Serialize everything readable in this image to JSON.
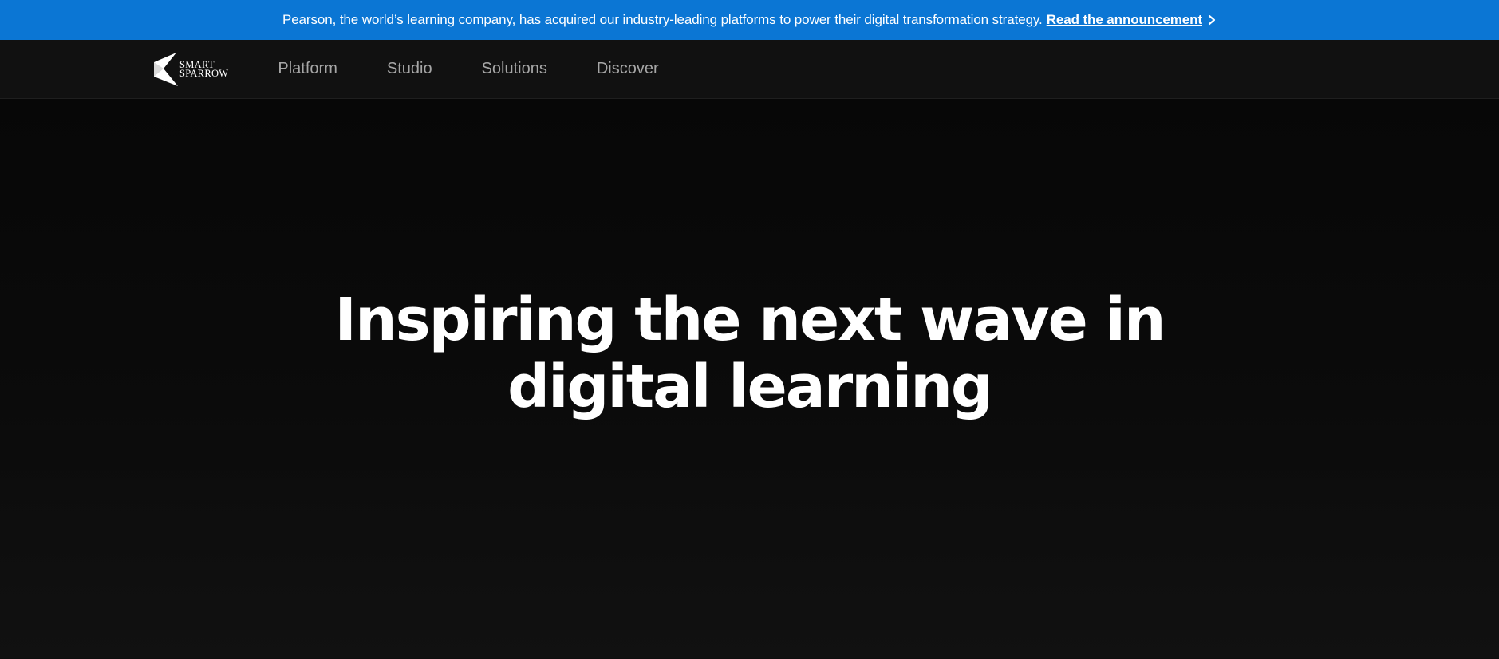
{
  "announcement": {
    "text": "Pearson, the world’s learning company, has acquired our industry-leading platforms to power their digital transformation strategy.",
    "link_label": "Read the announcement",
    "link_icon": "chevron-right-icon",
    "background_color": "#0b76d4"
  },
  "header": {
    "logo": {
      "line1": "SMART",
      "line2": "SPARROW"
    },
    "nav": [
      {
        "label": "Platform"
      },
      {
        "label": "Studio"
      },
      {
        "label": "Solutions"
      },
      {
        "label": "Discover"
      }
    ]
  },
  "hero": {
    "title_line1": "Inspiring the next wave in",
    "title_line2": "digital learning"
  },
  "colors": {
    "page_background": "#0e0e0e",
    "nav_text": "#a6a6a6",
    "hero_text": "#ffffff"
  }
}
